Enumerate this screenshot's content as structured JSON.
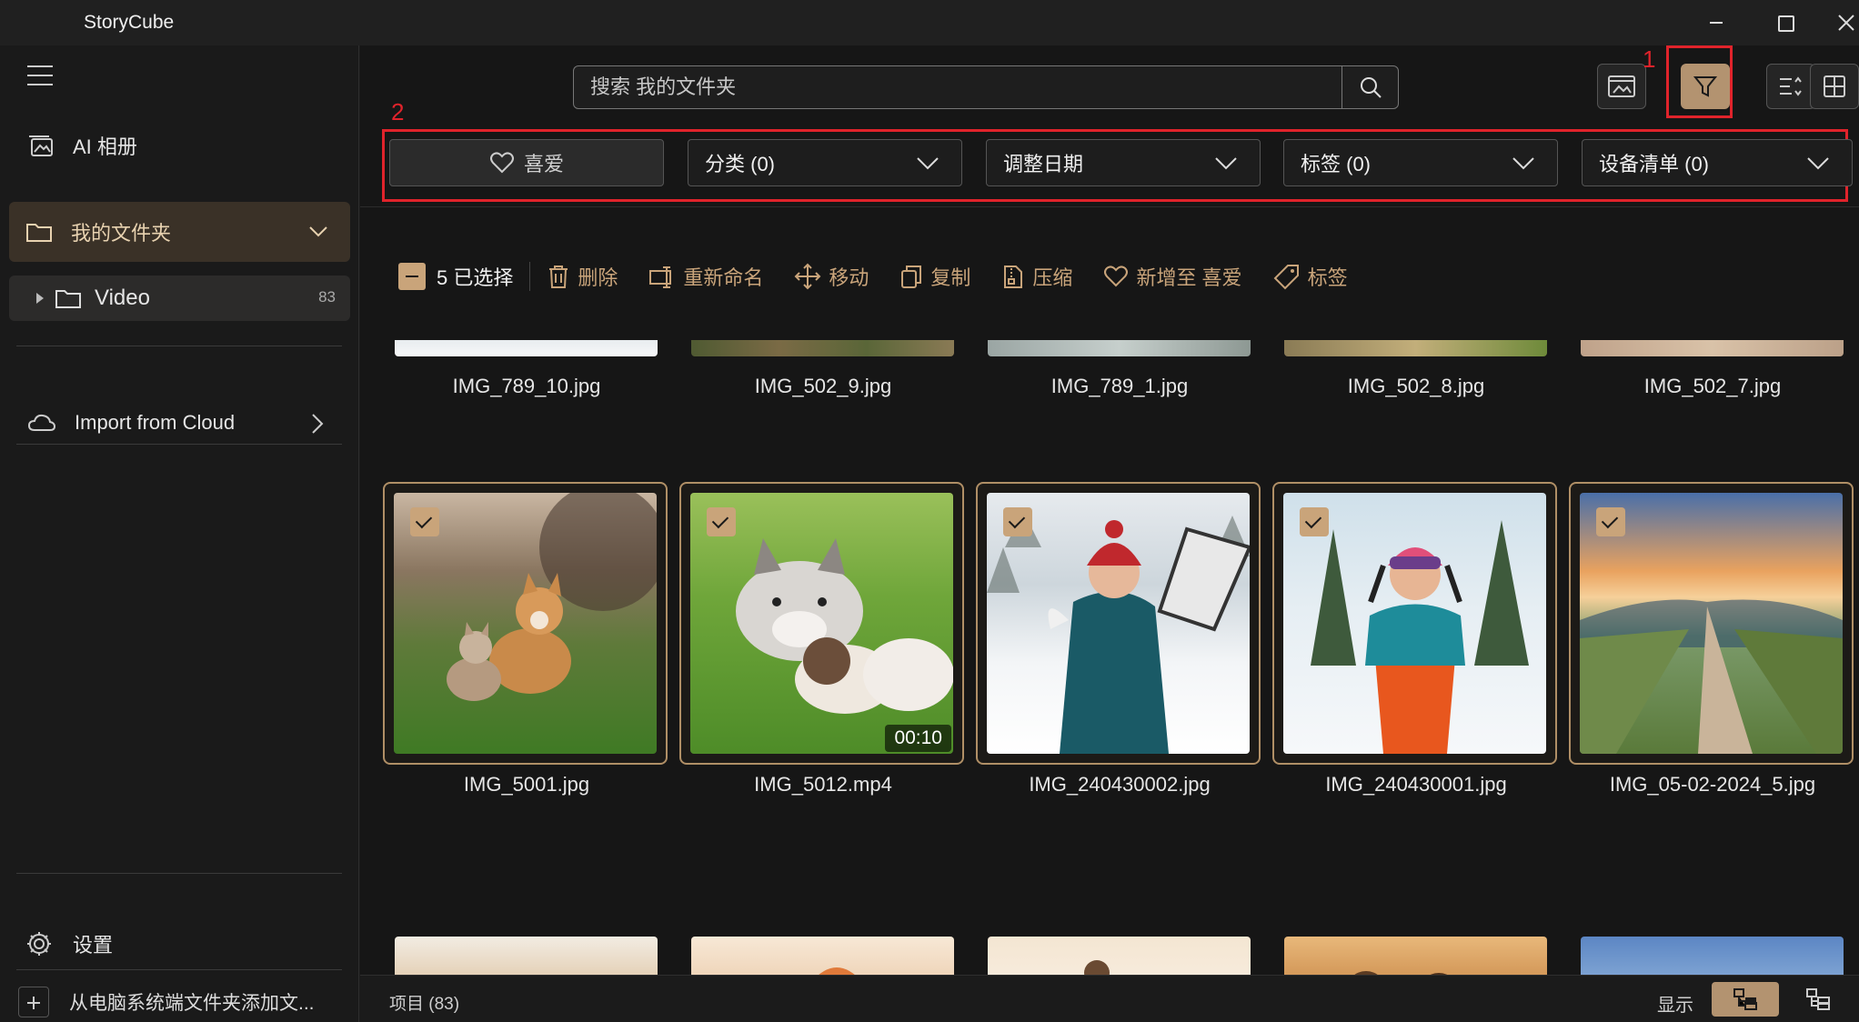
{
  "window": {
    "title": "StoryCube"
  },
  "sidebar": {
    "ai_album": "AI 相册",
    "my_folder": "我的文件夹",
    "video": {
      "label": "Video",
      "count": "83"
    },
    "import_cloud": "Import from Cloud",
    "settings": "设置",
    "add_folder": "从电脑系统端文件夹添加文..."
  },
  "search": {
    "placeholder": "搜索 我的文件夹"
  },
  "annotations": {
    "one": "1",
    "two": "2"
  },
  "filters": {
    "favorite": "喜爱",
    "category": "分类 (0)",
    "date": "调整日期",
    "tags": "标签 (0)",
    "devices": "设备清单 (0)"
  },
  "selection": {
    "count_label": "5 已选择",
    "actions": {
      "delete": "删除",
      "rename": "重新命名",
      "move": "移动",
      "copy": "复制",
      "compress": "压缩",
      "add_fav": "新增至 喜爱",
      "tag": "标签"
    }
  },
  "grid": {
    "row1": [
      "IMG_789_10.jpg",
      "IMG_502_9.jpg",
      "IMG_789_1.jpg",
      "IMG_502_8.jpg",
      "IMG_502_7.jpg"
    ],
    "row2": [
      {
        "name": "IMG_5001.jpg"
      },
      {
        "name": "IMG_5012.mp4",
        "duration": "00:10"
      },
      {
        "name": "IMG_240430002.jpg"
      },
      {
        "name": "IMG_240430001.jpg"
      },
      {
        "name": "IMG_05-02-2024_5.jpg"
      }
    ]
  },
  "status": {
    "items": "项目 (83)",
    "display": "显示"
  },
  "colors": {
    "accent": "#c9a47a",
    "annotation": "#e0232b",
    "background": "#161616"
  }
}
